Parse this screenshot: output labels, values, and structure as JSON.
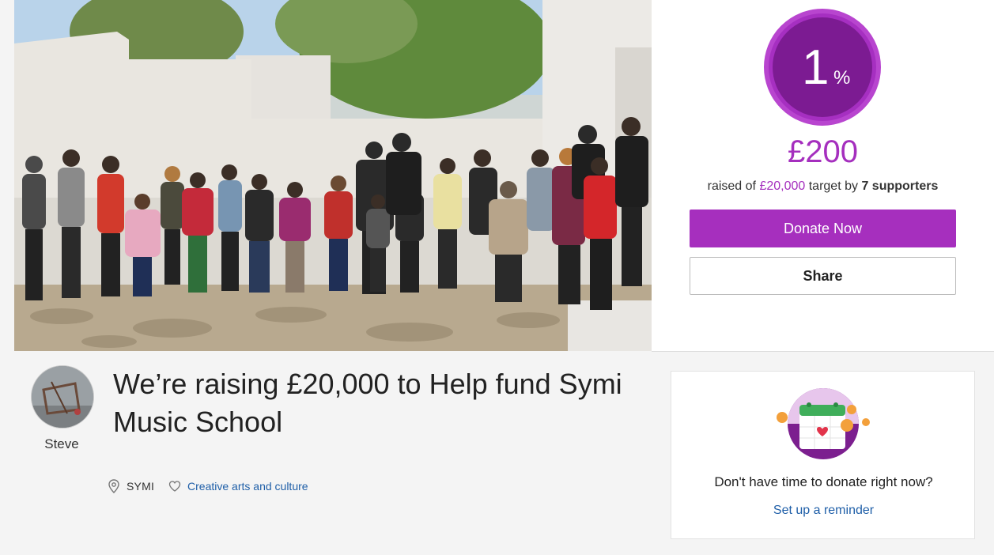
{
  "hero": {
    "image": "group-photo"
  },
  "progress": {
    "percent": 1,
    "number": "1",
    "symbol": "%"
  },
  "donation": {
    "amount": "£200",
    "raised_prefix": "raised of",
    "target": "£20,000",
    "target_suffix": "target by",
    "supporters": "7 supporters",
    "donate_label": "Donate Now",
    "share_label": "Share"
  },
  "campaign": {
    "owner": "Steve",
    "title": "We’re raising £20,000 to Help fund Symi Music School",
    "location": "SYMI",
    "category": "Creative arts and culture"
  },
  "reminder": {
    "question": "Don't have time to donate right now?",
    "link_label": "Set up a reminder"
  },
  "colors": {
    "brand_purple": "#a62fbe",
    "link_blue": "#1f5fa8"
  }
}
